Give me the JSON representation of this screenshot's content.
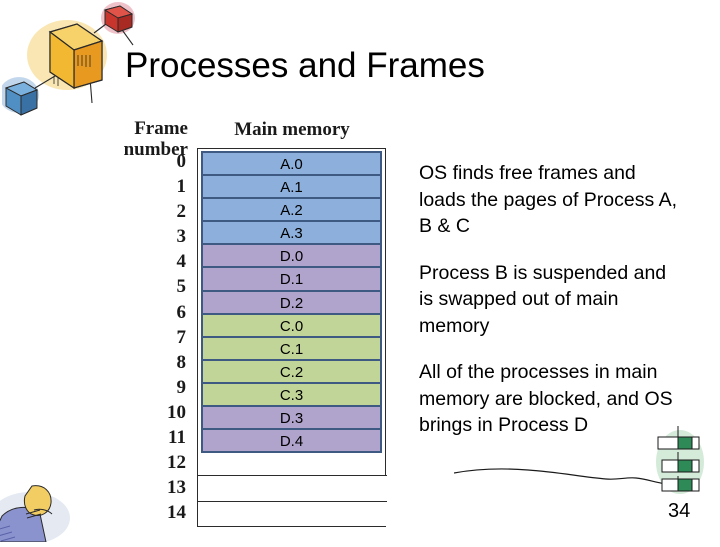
{
  "slide": {
    "title": "Processes and Frames",
    "page_number": "34"
  },
  "diagram": {
    "frame_label_line1": "Frame",
    "frame_label_line2": "number",
    "memory_label": "Main memory",
    "frame_numbers": [
      "0",
      "1",
      "2",
      "3",
      "4",
      "5",
      "6",
      "7",
      "8",
      "9",
      "10",
      "11",
      "12",
      "13",
      "14"
    ],
    "rows": [
      {
        "frame": "0",
        "label": "A.0",
        "color_name": "blue",
        "color": "#8cafdb"
      },
      {
        "frame": "1",
        "label": "A.1",
        "color_name": "blue",
        "color": "#8cafdb"
      },
      {
        "frame": "2",
        "label": "A.2",
        "color_name": "blue",
        "color": "#8cafdb"
      },
      {
        "frame": "3",
        "label": "A.3",
        "color_name": "blue",
        "color": "#8cafdb"
      },
      {
        "frame": "4",
        "label": "D.0",
        "color_name": "purple",
        "color": "#b0a3cc"
      },
      {
        "frame": "5",
        "label": "D.1",
        "color_name": "purple",
        "color": "#b0a3cc"
      },
      {
        "frame": "6",
        "label": "D.2",
        "color_name": "purple",
        "color": "#b0a3cc"
      },
      {
        "frame": "7",
        "label": "C.0",
        "color_name": "green",
        "color": "#c2d598"
      },
      {
        "frame": "8",
        "label": "C.1",
        "color_name": "green",
        "color": "#c2d598"
      },
      {
        "frame": "9",
        "label": "C.2",
        "color_name": "green",
        "color": "#c2d598"
      },
      {
        "frame": "10",
        "label": "C.3",
        "color_name": "green",
        "color": "#c2d598"
      },
      {
        "frame": "11",
        "label": "D.3",
        "color_name": "purple",
        "color": "#b0a3cc"
      },
      {
        "frame": "12",
        "label": "D.4",
        "color_name": "purple",
        "color": "#b0a3cc"
      },
      {
        "frame": "13",
        "label": "",
        "color_name": "empty",
        "color": "#ffffff"
      },
      {
        "frame": "14",
        "label": "",
        "color_name": "empty",
        "color": "#ffffff"
      }
    ]
  },
  "notes": {
    "paragraphs": [
      "OS finds free frames and loads the pages of Process A, B & C",
      "Process B is suspended and is swapped out of main memory",
      "All of the processes in main memory are blocked, and OS brings in Process D"
    ]
  },
  "clipart": {
    "top_left": "connected-boxes-clipart",
    "bottom_left": "person-clipart",
    "bottom_right": "hierarchy-boxes-clipart",
    "squiggle": "hand-drawn-line"
  }
}
